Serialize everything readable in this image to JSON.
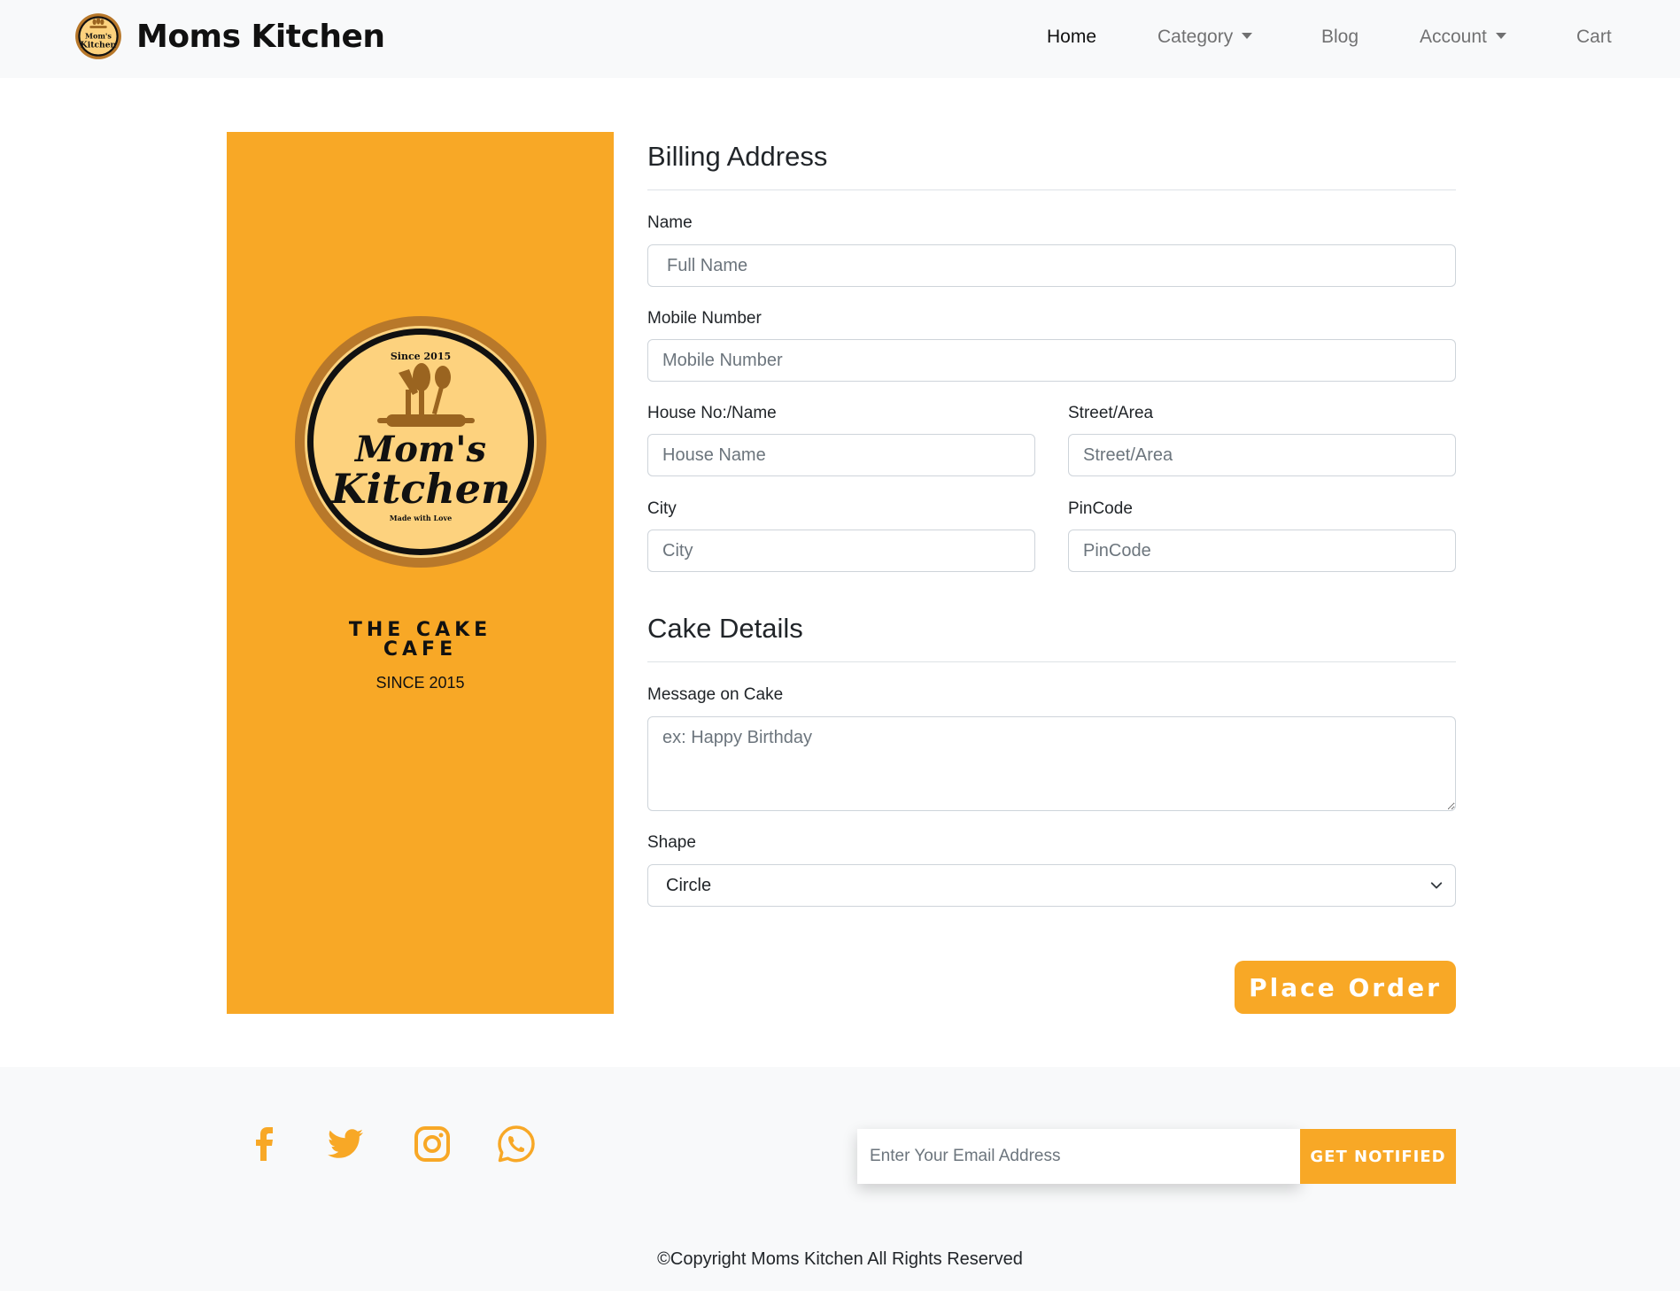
{
  "brand": {
    "name": "Moms Kitchen",
    "logo": {
      "top_text": "Since 2015",
      "line1": "Mom's",
      "line2": "Kitchen",
      "bottom_text": "Made with Love"
    }
  },
  "nav": {
    "items": [
      {
        "label": "Home",
        "active": true,
        "dropdown": false
      },
      {
        "label": "Category",
        "active": false,
        "dropdown": true
      },
      {
        "label": "Blog",
        "active": false,
        "dropdown": false
      },
      {
        "label": "Account",
        "active": false,
        "dropdown": true
      },
      {
        "label": "Cart",
        "active": false,
        "dropdown": false
      }
    ]
  },
  "promo": {
    "title_line1": "THE CAKE",
    "title_line2": "CAFE",
    "since": "SINCE 2015"
  },
  "billing": {
    "title": "Billing Address",
    "name_label": "Name",
    "name_placeholder": "Full Name",
    "mobile_label": "Mobile Number",
    "mobile_placeholder": "Mobile Number",
    "house_label": "House No:/Name",
    "house_placeholder": "House Name",
    "street_label": "Street/Area",
    "street_placeholder": "Street/Area",
    "city_label": "City",
    "city_placeholder": "City",
    "pin_label": "PinCode",
    "pin_placeholder": "PinCode"
  },
  "cake": {
    "title": "Cake Details",
    "message_label": "Message on Cake",
    "message_placeholder": "ex: Happy Birthday",
    "shape_label": "Shape",
    "shape_value": "Circle"
  },
  "order_button": "Place Order",
  "footer": {
    "social_icons": [
      "facebook-icon",
      "twitter-icon",
      "instagram-icon",
      "whatsapp-icon"
    ],
    "email_placeholder": "Enter Your Email Address",
    "notify_button": "GET NOTIFIED",
    "copyright": "©Copyright Moms Kitchen All Rights Reserved"
  },
  "colors": {
    "accent": "#f8a826",
    "navbar_bg": "#f8f9fa",
    "logo_fill": "#fdd27e",
    "logo_ring": "#b8782a"
  }
}
